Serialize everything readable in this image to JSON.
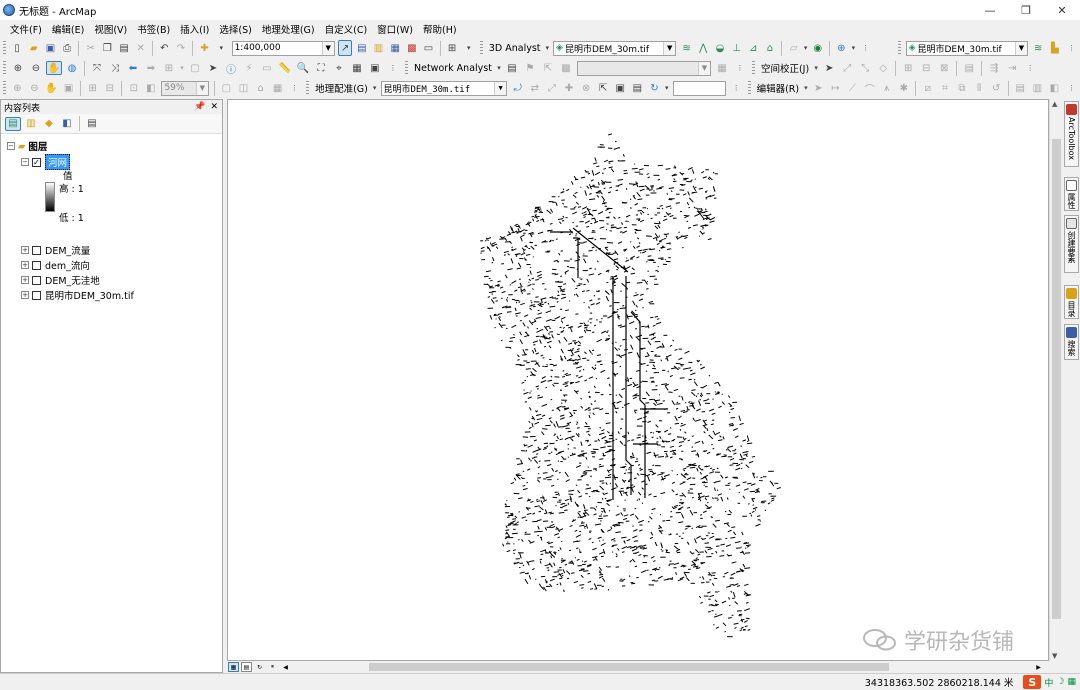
{
  "window": {
    "title": "无标题 - ArcMap",
    "controls": [
      "—",
      "❐",
      "✕"
    ]
  },
  "menubar": {
    "items": [
      "文件(F)",
      "编辑(E)",
      "视图(V)",
      "书签(B)",
      "插入(I)",
      "选择(S)",
      "地理处理(G)",
      "自定义(C)",
      "窗口(W)",
      "帮助(H)"
    ]
  },
  "toolbar1": {
    "scale": "1:400,000",
    "analyst3d": "3D Analyst",
    "layer_combo": "昆明市DEM_30m.tif",
    "layer_combo2": "昆明市DEM_30m.tif"
  },
  "toolbar2": {
    "network_analyst": "Network Analyst",
    "spatial_adjust": "空间校正(J)"
  },
  "toolbar3": {
    "zoom_pct": "59%",
    "georef": "地理配准(G)",
    "georef_layer": "昆明市DEM_30m.tif",
    "editor": "编辑器(R)"
  },
  "toc": {
    "title": "内容列表",
    "pin": "ᵖ",
    "close": "✕",
    "root": "图层",
    "active_layer": {
      "name": "河网",
      "legend_title": "值",
      "high": "高 : 1",
      "low": "低 : 1"
    },
    "layers": [
      "DEM_流量",
      "dem_流向",
      "DEM_无洼地",
      "昆明市DEM_30m.tif"
    ]
  },
  "rdock": {
    "tabs": [
      "ArcToolbox",
      "属性",
      "创建要素",
      "目录",
      "搜索"
    ]
  },
  "status": {
    "coords": "34318363.502  2860218.144 米"
  },
  "ime": {
    "badge": "S",
    "lang": "中",
    "moon": "☽"
  },
  "watermark": {
    "text": "学研杂货铺"
  },
  "colors": {
    "selection": "#3399ff",
    "map_bg": "#ffffff",
    "river": "#000000"
  }
}
